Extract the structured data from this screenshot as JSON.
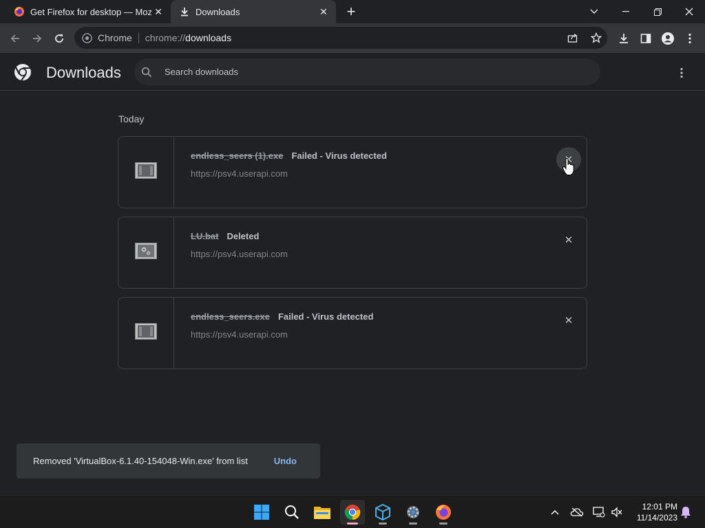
{
  "tabs": [
    {
      "title": "Get Firefox for desktop — Mozill",
      "icon": "firefox-icon",
      "active": false
    },
    {
      "title": "Downloads",
      "icon": "download-icon",
      "active": true
    }
  ],
  "toolbar": {
    "site_label": "Chrome",
    "url_scheme": "chrome://",
    "url_host": "downloads"
  },
  "header": {
    "title": "Downloads",
    "search_placeholder": "Search downloads"
  },
  "list": {
    "date_heading": "Today",
    "items": [
      {
        "filename": "endless_seers (1).exe",
        "status": "Failed - Virus detected",
        "source": "https://psv4.userapi.com",
        "icon": "exe-file-icon"
      },
      {
        "filename": "LU.bat",
        "status": "Deleted",
        "source": "https://psv4.userapi.com",
        "icon": "bat-file-icon"
      },
      {
        "filename": "endless_seers.exe",
        "status": "Failed - Virus detected",
        "source": "https://psv4.userapi.com",
        "icon": "exe-file-icon"
      }
    ]
  },
  "toast": {
    "message": "Removed 'VirtualBox-6.1.40-154048-Win.exe' from list",
    "undo_label": "Undo"
  },
  "taskbar": {
    "apps": [
      "windows-start-icon",
      "search-icon",
      "file-explorer-icon",
      "chrome-icon",
      "virtualbox-icon",
      "settings-icon",
      "firefox-icon"
    ],
    "time": "12:01 PM",
    "date": "11/14/2023"
  },
  "colors": {
    "background": "#202124",
    "toolbar": "#35363a",
    "link_accent": "#8ab4f8"
  }
}
